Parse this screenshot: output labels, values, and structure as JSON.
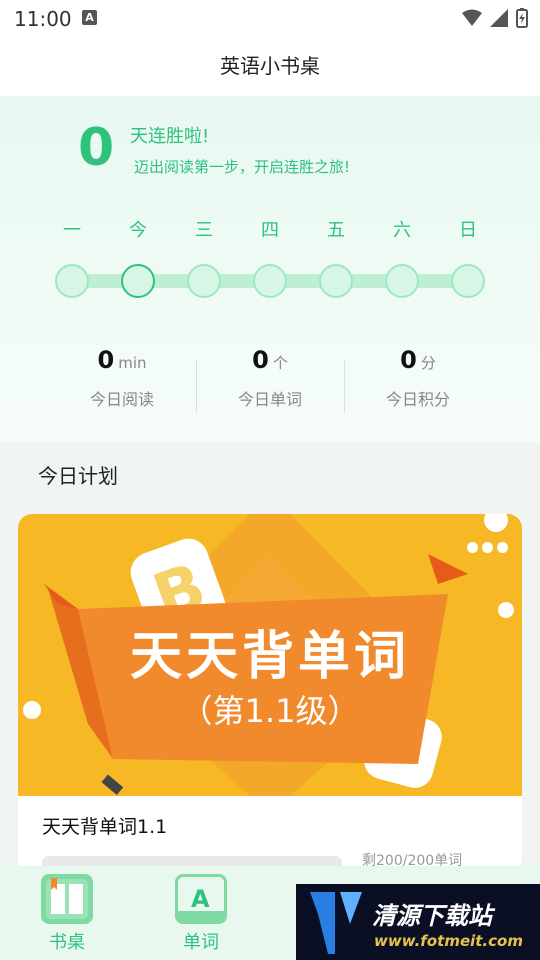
{
  "status_bar": {
    "time": "11:00",
    "notification_letter": "A"
  },
  "header": {
    "title": "英语小书桌"
  },
  "streak": {
    "count": "0",
    "title": "天连胜啦!",
    "subtitle": "迈出阅读第一步，开启连胜之旅!",
    "days": [
      "一",
      "今",
      "三",
      "四",
      "五",
      "六",
      "日"
    ],
    "today_index": 1
  },
  "stats": [
    {
      "value": "0",
      "unit": "min",
      "label": "今日阅读"
    },
    {
      "value": "0",
      "unit": "个",
      "label": "今日单词"
    },
    {
      "value": "0",
      "unit": "分",
      "label": "今日积分"
    }
  ],
  "plan": {
    "heading": "今日计划",
    "banner_title": "天天背单词",
    "banner_subtitle": "（第1.1级）",
    "card_title": "天天背单词1.1",
    "remaining": "剩200/200单词",
    "progress": 0
  },
  "bottom_nav": {
    "items": [
      {
        "label": "书桌",
        "icon": "book-icon"
      },
      {
        "label": "单词",
        "icon": "letter-a-icon"
      }
    ]
  },
  "watermark": {
    "text": "清源下载站",
    "url": "www.fotmeit.com"
  },
  "colors": {
    "accent": "#2ec27e",
    "banner": "#f7b826",
    "banner_ribbon": "#f08a2c"
  }
}
